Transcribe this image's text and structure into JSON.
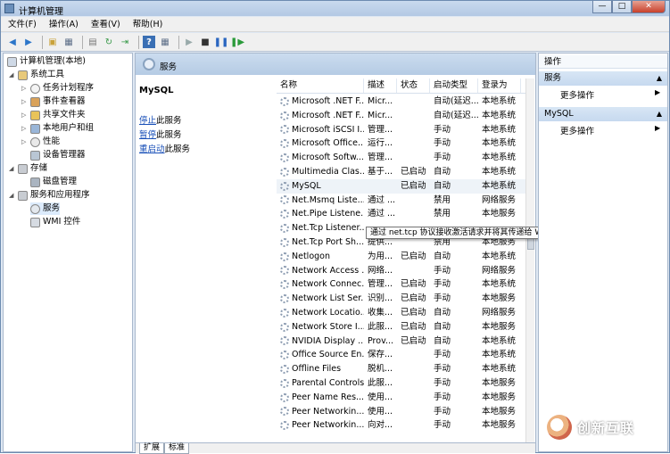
{
  "window": {
    "title": "计算机管理",
    "buttons": {
      "min": "—",
      "max": "□",
      "close": "✕"
    }
  },
  "menu": [
    "文件(F)",
    "操作(A)",
    "查看(V)",
    "帮助(H)"
  ],
  "tree": {
    "root": "计算机管理(本地)",
    "system_tools": "系统工具",
    "task_scheduler": "任务计划程序",
    "event_viewer": "事件查看器",
    "shared_folders": "共享文件夹",
    "local_users": "本地用户和组",
    "performance": "性能",
    "device_manager": "设备管理器",
    "storage": "存储",
    "disk_management": "磁盘管理",
    "services_apps": "服务和应用程序",
    "services": "服务",
    "wmi": "WMI 控件"
  },
  "center": {
    "header": "服务",
    "selected_service": "MySQL",
    "actions": {
      "stop_link": "停止",
      "stop_rest": "此服务",
      "pause_link": "暂停",
      "pause_rest": "此服务",
      "restart_link": "重启动",
      "restart_rest": "此服务"
    },
    "columns": [
      "名称",
      "描述",
      "状态",
      "启动类型",
      "登录为"
    ],
    "rows": [
      [
        "Microsoft .NET F...",
        "Micr...",
        "",
        "自动(延迟...",
        "本地系统"
      ],
      [
        "Microsoft .NET F...",
        "Micr...",
        "",
        "自动(延迟...",
        "本地系统"
      ],
      [
        "Microsoft iSCSI I...",
        "管理...",
        "",
        "手动",
        "本地系统"
      ],
      [
        "Microsoft Office...",
        "运行...",
        "",
        "手动",
        "本地系统"
      ],
      [
        "Microsoft Softw...",
        "管理...",
        "",
        "手动",
        "本地系统"
      ],
      [
        "Multimedia Clas...",
        "基于...",
        "已启动",
        "自动",
        "本地系统"
      ],
      [
        "MySQL",
        "",
        "已启动",
        "自动",
        "本地系统"
      ],
      [
        "Net.Msmq Liste...",
        "通过 ...",
        "",
        "禁用",
        "网络服务"
      ],
      [
        "Net.Pipe Listene...",
        "通过 ...",
        "",
        "禁用",
        "本地服务"
      ],
      [
        "Net.Tcp Listener...",
        "",
        "",
        "",
        ""
      ],
      [
        "Net.Tcp Port Sh...",
        "提供...",
        "",
        "禁用",
        "本地服务"
      ],
      [
        "Netlogon",
        "为用...",
        "已启动",
        "自动",
        "本地系统"
      ],
      [
        "Network Access ...",
        "网络...",
        "",
        "手动",
        "网络服务"
      ],
      [
        "Network Connec...",
        "管理...",
        "已启动",
        "手动",
        "本地系统"
      ],
      [
        "Network List Ser...",
        "识别...",
        "已启动",
        "手动",
        "本地服务"
      ],
      [
        "Network Locatio...",
        "收集...",
        "已启动",
        "自动",
        "网络服务"
      ],
      [
        "Network Store I...",
        "此服...",
        "已启动",
        "自动",
        "本地服务"
      ],
      [
        "NVIDIA Display ...",
        "Prov...",
        "已启动",
        "自动",
        "本地系统"
      ],
      [
        "Office Source En...",
        "保存...",
        "",
        "手动",
        "本地系统"
      ],
      [
        "Offline Files",
        "脱机...",
        "",
        "手动",
        "本地系统"
      ],
      [
        "Parental Controls",
        "此服...",
        "",
        "手动",
        "本地服务"
      ],
      [
        "Peer Name Res...",
        "使用...",
        "",
        "手动",
        "本地服务"
      ],
      [
        "Peer Networkin...",
        "使用...",
        "",
        "手动",
        "本地服务"
      ],
      [
        "Peer Networkin...",
        "向对...",
        "",
        "手动",
        "本地服务"
      ]
    ],
    "tabs": [
      "扩展",
      "标准"
    ],
    "tooltip": "通过 net.tcp 协议接收激活请求并将其传递给 Windows 进程激活服务。"
  },
  "ops": {
    "title": "操作",
    "section1": "服务",
    "more1": "更多操作",
    "section2": "MySQL",
    "more2": "更多操作"
  },
  "watermark": "创新互联"
}
